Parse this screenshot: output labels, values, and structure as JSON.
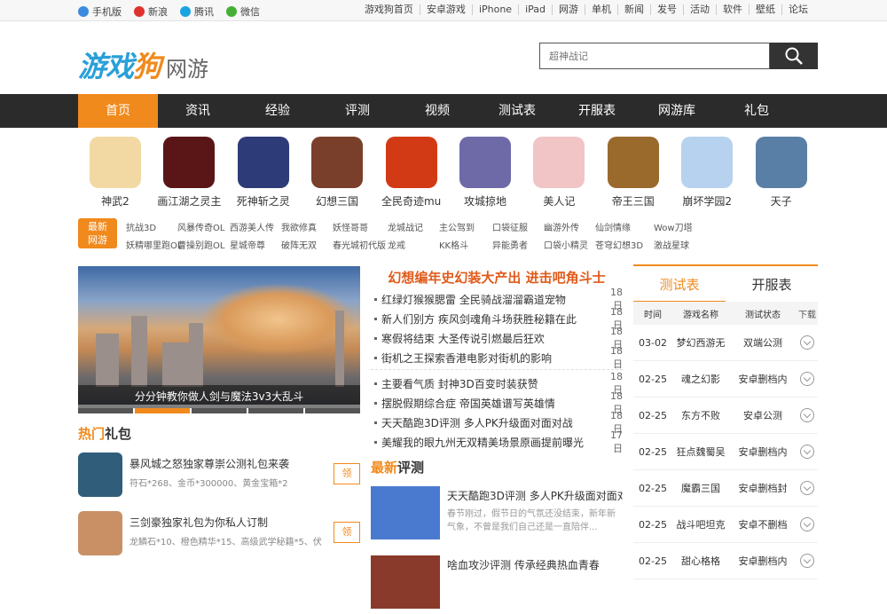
{
  "topbar": {
    "left": [
      {
        "label": "手机版",
        "icon": "phone-icon",
        "color": "#3d8be0"
      },
      {
        "label": "新浪",
        "icon": "weibo-icon",
        "color": "#e0322c"
      },
      {
        "label": "腾讯",
        "icon": "tencent-icon",
        "color": "#1aa3e0"
      },
      {
        "label": "微信",
        "icon": "wechat-icon",
        "color": "#45b035"
      }
    ],
    "right": [
      "游戏狗首页",
      "安卓游戏",
      "iPhone",
      "iPad",
      "网游",
      "单机",
      "新闻",
      "发号",
      "活动",
      "软件",
      "壁纸",
      "论坛"
    ]
  },
  "header": {
    "logo_main": "游戏",
    "logo_accent": "狗",
    "logo_sub": "网游",
    "search_placeholder": "超神战记"
  },
  "nav": [
    "首页",
    "资讯",
    "经验",
    "评测",
    "视频",
    "测试表",
    "开服表",
    "网游库",
    "礼包"
  ],
  "games": [
    {
      "name": "神武2",
      "color": "#f2d9a3"
    },
    {
      "name": "画江湖之灵主",
      "color": "#5a1616"
    },
    {
      "name": "死神斩之灵",
      "color": "#2d3c78"
    },
    {
      "name": "幻想三国",
      "color": "#7a3f2a"
    },
    {
      "name": "全民奇迹mu",
      "color": "#d23a15"
    },
    {
      "name": "攻城掠地",
      "color": "#6e6aa8"
    },
    {
      "name": "美人记",
      "color": "#f1c5c5"
    },
    {
      "name": "帝王三国",
      "color": "#9a6a2c"
    },
    {
      "name": "崩坏学园2",
      "color": "#b7d2ee"
    },
    {
      "name": "天子",
      "color": "#5a7fa6"
    }
  ],
  "newest": {
    "badge_line1": "最新",
    "badge_line2": "网游",
    "row1": [
      "抗战3D",
      "风暴传奇OL",
      "西游美人传",
      "我欲修真",
      "妖怪哥哥",
      "龙城战记",
      "主公驾到",
      "口袋征服",
      "幽游外传",
      "仙剑情缘",
      "Wow刀塔"
    ],
    "row2": [
      "妖精哪里跑OL",
      "曹操别跑OL",
      "星城帝尊",
      "破阵无双",
      "春光城初代版",
      "龙戒",
      "KK格斗",
      "异能勇者",
      "口袋小精灵",
      "苍穹幻想3D",
      "激战星球"
    ]
  },
  "slider": {
    "caption": "分分钟教你做人剑与魔法3v3大乱斗"
  },
  "gifts": {
    "title_accent": "热门",
    "title_rest": "礼包",
    "items": [
      {
        "title": "暴风城之怒独家尊崇公测礼包来袭",
        "desc": "符石*268、金币*300000、黄金宝箱*2",
        "button": "领",
        "color": "#2f5d7a"
      },
      {
        "title": "三剑豪独家礼包为你私人订制",
        "desc": "龙鳞石*10、橙色精华*15、高级武学秘籍*5、伏",
        "button": "领",
        "color": "#c99066"
      }
    ]
  },
  "headline": "幻想编年史幻装大产出 进击吧角斗士",
  "news1": [
    {
      "text": "红绿灯猴猴腮雷 全民骑战溜溜霸道宠物",
      "date": "18日"
    },
    {
      "text": "新人们别方 疾风剑魂角斗场获胜秘籍在此",
      "date": "18日"
    },
    {
      "text": "寒假将结束 大圣传说引燃最后狂欢",
      "date": "18日"
    },
    {
      "text": "街机之王探索香港电影对街机的影响",
      "date": "18日"
    }
  ],
  "news2": [
    {
      "text": "主要看气质 封神3D百变时装获赞",
      "date": "18日"
    },
    {
      "text": "摆脱假期综合症 帝国英雄谱写英雄情",
      "date": "18日"
    },
    {
      "text": "天天酷跑3D评测 多人PK升级面对面对战",
      "date": "18日"
    },
    {
      "text": "美耀我的眼九州无双精美场景原画提前曝光",
      "date": "17日"
    }
  ],
  "reviews": {
    "title_accent": "最新",
    "title_rest": "评测",
    "items": [
      {
        "title": "天天酷跑3D评测 多人PK升级面对面对",
        "desc": "春节刚过，假节日的气氛还没结束，新年新气象，不曾是我们自己还是一直陪伴...",
        "color": "#4a7ad0"
      },
      {
        "title": "啥血攻沙评测 传承经典热血青春",
        "desc": "",
        "color": "#8a3a2a"
      }
    ]
  },
  "side": {
    "tabs": [
      "测试表",
      "开服表"
    ],
    "headers": [
      "时间",
      "游戏名称",
      "测试状态",
      "下载"
    ],
    "rows": [
      {
        "date": "03-02",
        "name": "梦幻西游无",
        "status": "双端公测"
      },
      {
        "date": "02-25",
        "name": "魂之幻影",
        "status": "安卓删档内"
      },
      {
        "date": "02-25",
        "name": "东方不败",
        "status": "安卓公测"
      },
      {
        "date": "02-25",
        "name": "狂点魏蜀吴",
        "status": "安卓删档内"
      },
      {
        "date": "02-25",
        "name": "魔霸三国",
        "status": "安卓删档封"
      },
      {
        "date": "02-25",
        "name": "战斗吧坦克",
        "status": "安卓不删档"
      },
      {
        "date": "02-25",
        "name": "甜心格格",
        "status": "安卓删档内"
      }
    ]
  }
}
